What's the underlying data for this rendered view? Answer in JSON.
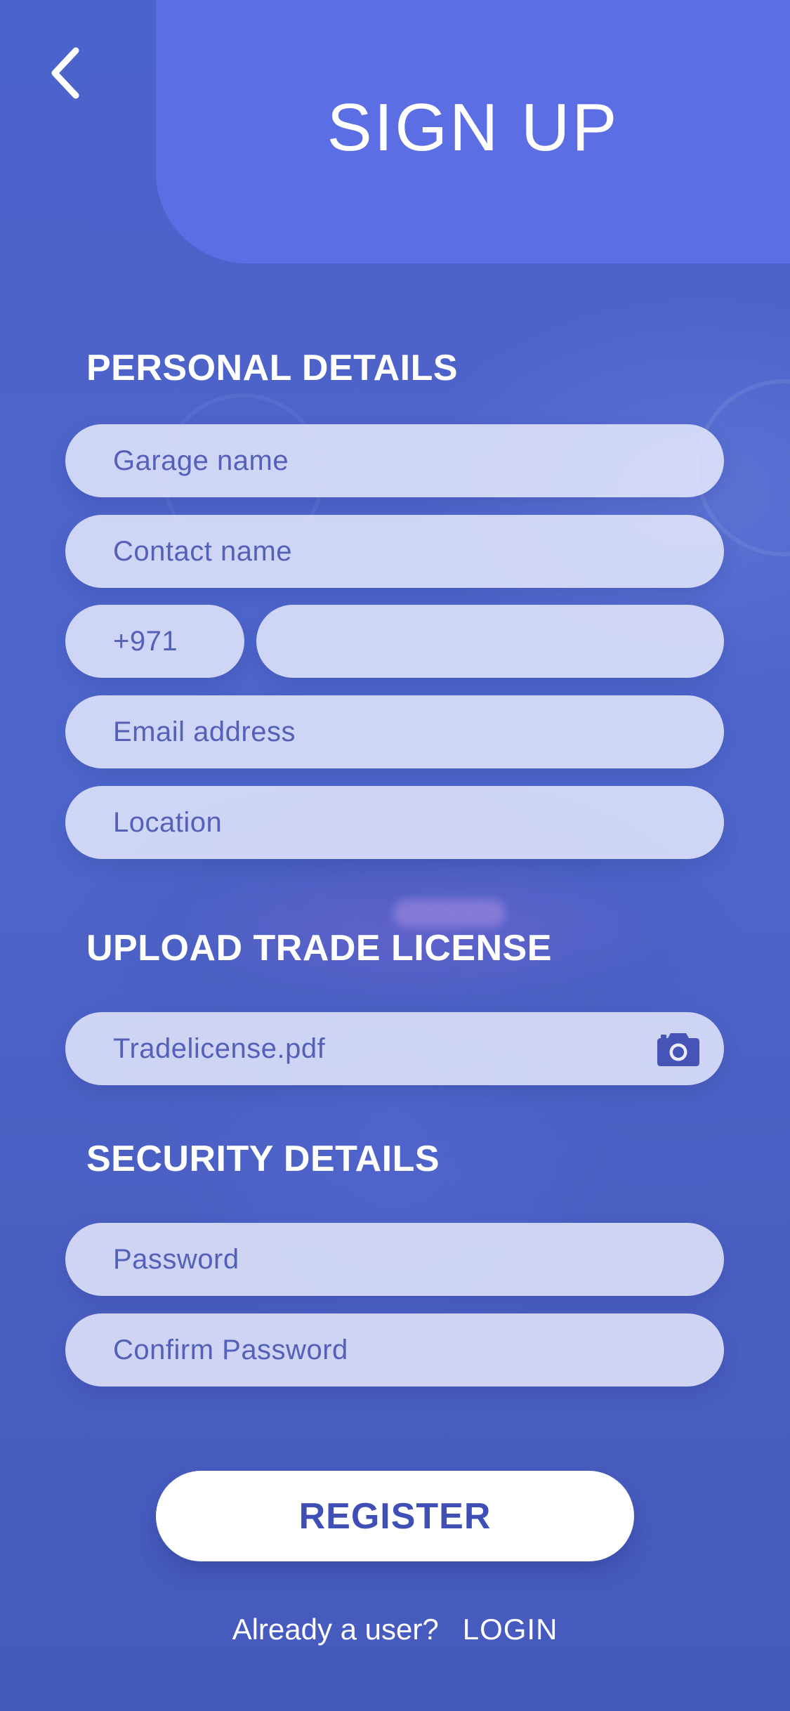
{
  "header": {
    "title": "SIGN UP",
    "back_icon": "chevron-left-icon"
  },
  "sections": {
    "personal": "PERSONAL DETAILS",
    "upload": "UPLOAD TRADE LICENSE",
    "security": "SECURITY DETAILS"
  },
  "personal": {
    "garage_name_placeholder": "Garage name",
    "contact_name_placeholder": "Contact name",
    "phone_code": "+971",
    "phone_number_value": "",
    "email_placeholder": "Email address",
    "location_placeholder": "Location"
  },
  "upload": {
    "file_name": "Tradelicense.pdf",
    "camera_icon": "camera-icon"
  },
  "security": {
    "password_placeholder": "Password",
    "confirm_password_placeholder": "Confirm Password"
  },
  "actions": {
    "register_label": "REGISTER"
  },
  "footer": {
    "prompt": "Already a user?",
    "login_label": "LOGIN"
  },
  "colors": {
    "background": "#4b63cc",
    "header_panel": "#5b6ee4",
    "field_fill": "#eceefc",
    "field_text": "#5560b8",
    "button_text": "#3f4fb5"
  }
}
